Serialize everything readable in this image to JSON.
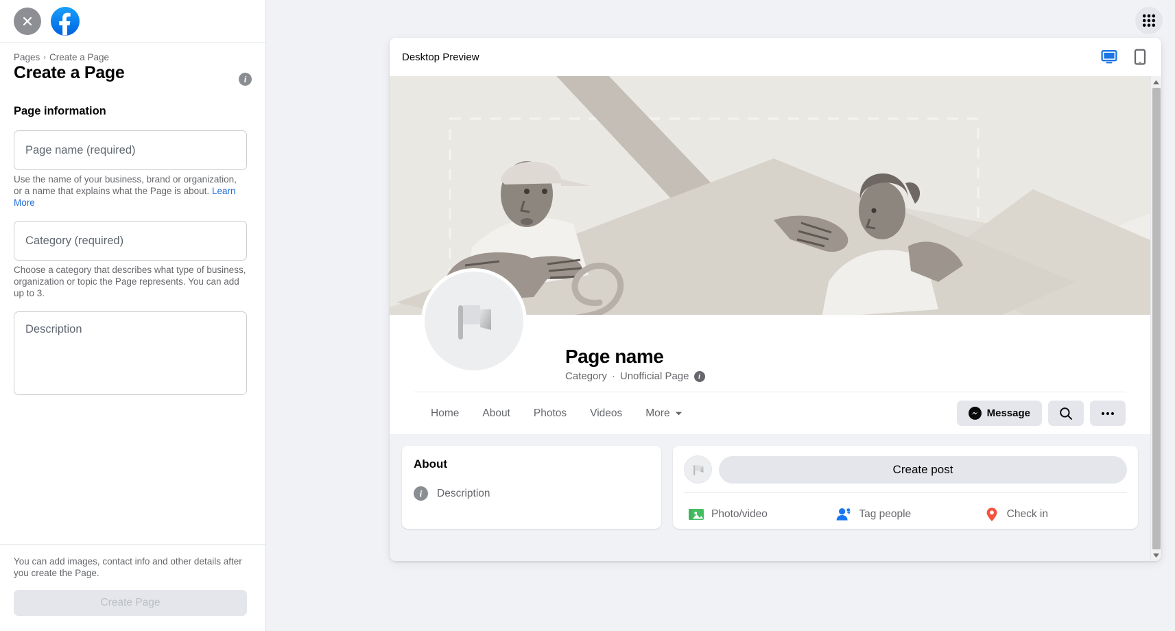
{
  "sidebar": {
    "close_icon": "close-x-icon",
    "logo_icon": "facebook-logo-icon",
    "breadcrumb": {
      "parent": "Pages",
      "separator": "›",
      "current": "Create a Page"
    },
    "page_title": "Create a Page",
    "info_icon_label": "i",
    "section_title": "Page information",
    "fields": [
      {
        "name": "page-name",
        "placeholder": "Page name (required)",
        "help": "Use the name of your business, brand or organization, or a name that explains what the Page is about.",
        "help_link": "Learn More"
      },
      {
        "name": "category",
        "placeholder": "Category (required)",
        "help": "Choose a category that describes what type of business, organization or topic the Page represents. You can add up to 3.",
        "help_link": ""
      },
      {
        "name": "description",
        "placeholder": "Description",
        "help": "",
        "help_link": ""
      }
    ],
    "footer_note": "You can add images, contact info and other details after you create the Page.",
    "create_button": "Create Page"
  },
  "header": {
    "apps_grid_icon": "apps-grid-icon"
  },
  "preview": {
    "title": "Desktop Preview",
    "devices": [
      {
        "name": "desktop",
        "icon": "desktop-monitor-icon",
        "active": true,
        "color": "#1b74e4"
      },
      {
        "name": "mobile",
        "icon": "mobile-phone-icon",
        "active": false,
        "color": "#65676b"
      }
    ],
    "profile": {
      "name": "Page name",
      "category": "Category",
      "separator": "·",
      "status": "Unofficial Page",
      "info_icon_label": "i",
      "avatar_icon": "flag-placeholder-icon"
    },
    "tabs": [
      {
        "label": "Home",
        "has_caret": false
      },
      {
        "label": "About",
        "has_caret": false
      },
      {
        "label": "Photos",
        "has_caret": false
      },
      {
        "label": "Videos",
        "has_caret": false
      },
      {
        "label": "More",
        "has_caret": true
      }
    ],
    "actions": {
      "message_label": "Message",
      "message_icon": "messenger-icon",
      "search_icon": "search-icon",
      "more_icon": "ellipsis-horizontal-icon"
    },
    "about_card": {
      "title": "About",
      "row_icon": "info-circle-icon",
      "row_icon_label": "i",
      "row_text": "Description"
    },
    "composer": {
      "avatar_icon": "flag-placeholder-icon",
      "placeholder": "Create post",
      "actions": [
        {
          "label": "Photo/video",
          "icon": "photo-video-icon",
          "color": "#41b35d"
        },
        {
          "label": "Tag people",
          "icon": "tag-people-icon",
          "color": "#1877f2"
        },
        {
          "label": "Check in",
          "icon": "location-pin-icon",
          "color": "#f5533d"
        }
      ]
    },
    "scrollbar": {
      "up_icon": "caret-up-icon",
      "down_icon": "caret-down-icon"
    }
  },
  "colors": {
    "brand_blue": "#1877f2",
    "link_blue": "#216fdb",
    "page_bg": "#f0f2f5",
    "grey_button": "#e4e6eb",
    "text_primary": "#050505",
    "text_secondary": "#65676b"
  }
}
